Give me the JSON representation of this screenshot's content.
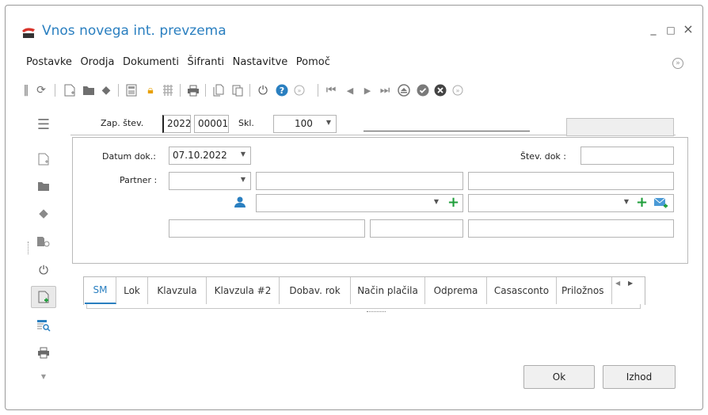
{
  "window": {
    "title": "Vnos novega int. prevzema",
    "minimize": "_",
    "maximize": "□",
    "close": "×"
  },
  "menu": [
    "Postavke",
    "Orodja",
    "Dokumenti",
    "Šifranti",
    "Nastavitve",
    "Pomoč"
  ],
  "toolbar_icons": [
    "drag-handle-icon",
    "refresh-icon",
    "new-document-icon",
    "folder-icon",
    "eraser-icon",
    "calculator-icon",
    "lock-icon",
    "grid-icon",
    "print-icon",
    "copy-icon",
    "paste-icon",
    "power-icon",
    "help-icon",
    "expand-icon",
    "first-record-icon",
    "previous-record-icon",
    "next-record-icon",
    "last-record-icon",
    "eject-icon",
    "confirm-icon",
    "cancel-icon",
    "more-icon"
  ],
  "header": {
    "zap_label": "Zap. štev.",
    "zap_year": "2022",
    "zap_number": "00001",
    "skl_label": "Skl.",
    "skl_value": "100"
  },
  "form": {
    "datum_label": "Datum dok.:",
    "datum_value": "07.10.2022",
    "stev_dok_label": "Štev. dok :",
    "partner_label": "Partner :"
  },
  "tabs": [
    "SM",
    "Lok",
    "Klavzula",
    "Klavzula #2",
    "Dobav. rok",
    "Način plačila",
    "Odprema",
    "Casasconto",
    "Priložnos"
  ],
  "active_tab": "SM",
  "buttons": {
    "ok": "Ok",
    "exit": "Izhod"
  },
  "colors": {
    "accent": "#2a7fc0",
    "add_green": "#1e9e3a"
  }
}
